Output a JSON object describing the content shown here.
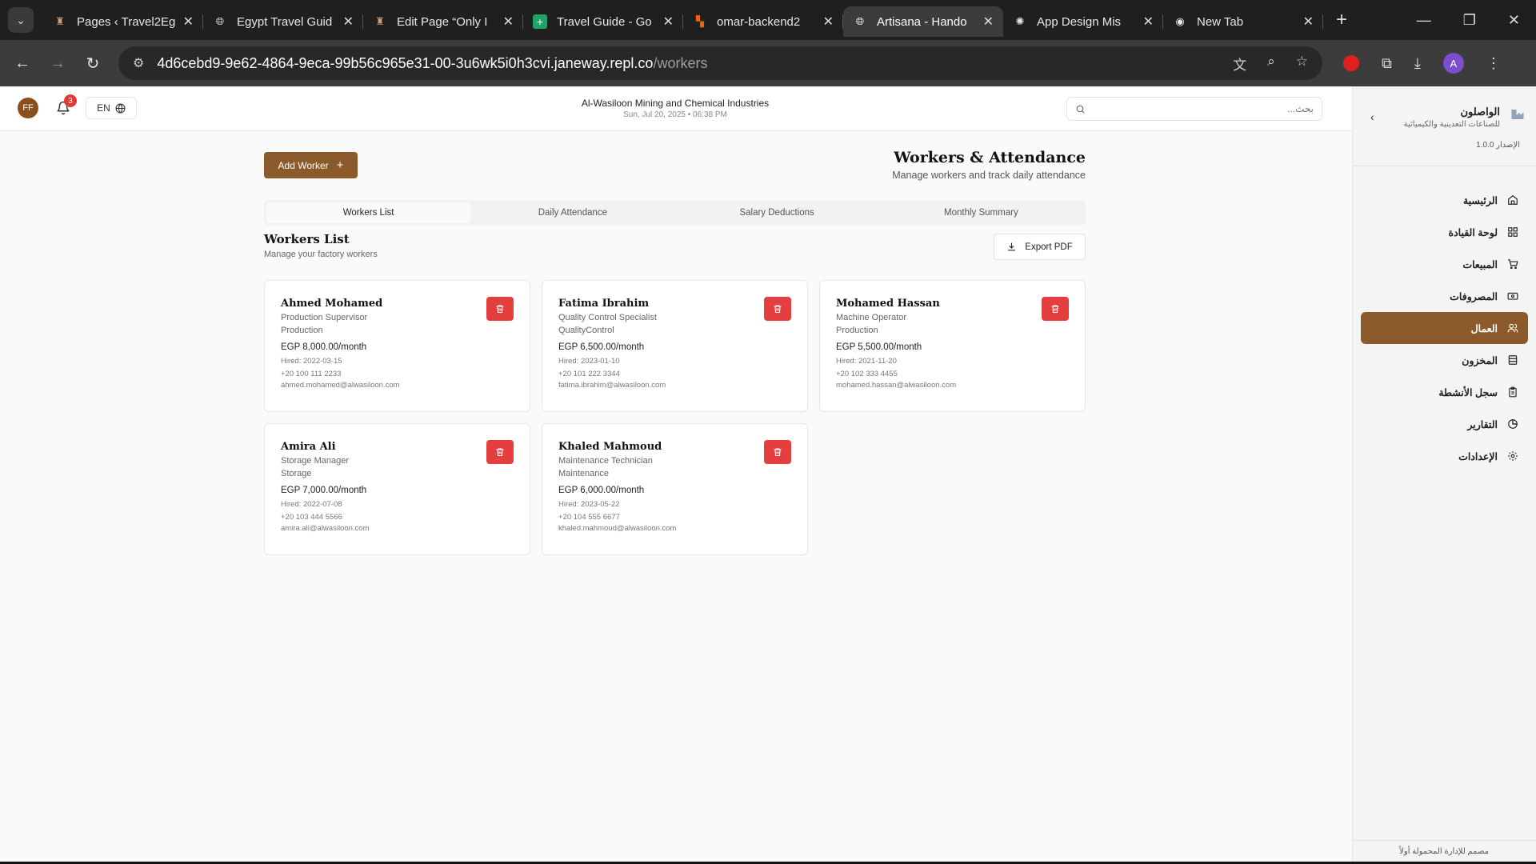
{
  "browser": {
    "tabs": [
      {
        "title": "Pages ‹ Travel2Eg",
        "icon": "site-logo-icon"
      },
      {
        "title": "Egypt Travel Guid",
        "icon": "globe-icon"
      },
      {
        "title": "Edit Page “Only I",
        "icon": "site-logo-icon"
      },
      {
        "title": "Travel Guide - Go",
        "icon": "sheets-icon"
      },
      {
        "title": "omar-backend2",
        "icon": "replit-icon"
      },
      {
        "title": "Artisana - Hando",
        "icon": "globe-icon",
        "active": true
      },
      {
        "title": "App Design Mis",
        "icon": "openai-icon"
      },
      {
        "title": "New Tab",
        "icon": "chrome-icon"
      }
    ],
    "url_host": "4d6cebd9-9e62-4864-9eca-99b56c965e31-00-3u6wk5i0h3cvi.janeway.repl.co",
    "url_path": "/workers",
    "profile_initial": "A"
  },
  "header": {
    "user_initials": "FF",
    "notification_count": "3",
    "language": "EN",
    "company_name": "Al-Wasiloon Mining and Chemical Industries",
    "datetime": "Sun, Jul 20, 2025 • 06:38 PM",
    "search_placeholder": "بحث..."
  },
  "sidebar": {
    "brand_name": "الواصلون",
    "brand_sub": "للصناعات التعدينية والكيميائية",
    "version": "الإصدار 1.0.0",
    "items": [
      {
        "label": "الرئيسية",
        "icon": "home-icon"
      },
      {
        "label": "لوحة القيادة",
        "icon": "dashboard-icon"
      },
      {
        "label": "المبيعات",
        "icon": "cart-icon"
      },
      {
        "label": "المصروفات",
        "icon": "wallet-icon"
      },
      {
        "label": "العمال",
        "icon": "users-icon",
        "active": true
      },
      {
        "label": "المخزون",
        "icon": "inventory-icon"
      },
      {
        "label": "سجل الأنشطة",
        "icon": "clipboard-icon"
      },
      {
        "label": "التقارير",
        "icon": "chart-icon"
      },
      {
        "label": "الإعدادات",
        "icon": "gear-icon"
      }
    ],
    "footer": "مصمم للإدارة المحمولة أولاً"
  },
  "page": {
    "add_worker_label": "Add Worker",
    "title": "Workers & Attendance",
    "subtitle": "Manage workers and track daily attendance",
    "tabs": [
      "Workers List",
      "Daily Attendance",
      "Salary Deductions",
      "Monthly Summary"
    ],
    "section_title": "Workers List",
    "section_subtitle": "Manage your factory workers",
    "export_label": "Export PDF"
  },
  "workers": [
    {
      "name": "Ahmed Mohamed",
      "role": "Production Supervisor",
      "dept": "Production",
      "salary": "EGP 8,000.00/month",
      "hired": "Hired: 2022-03-15",
      "phone": "+20 100 111 2233",
      "email": "ahmed.mohamed@alwasiloon.com"
    },
    {
      "name": "Fatima Ibrahim",
      "role": "Quality Control Specialist",
      "dept": "QualityControl",
      "salary": "EGP 6,500.00/month",
      "hired": "Hired: 2023-01-10",
      "phone": "+20 101 222 3344",
      "email": "fatima.ibrahim@alwasiloon.com"
    },
    {
      "name": "Mohamed Hassan",
      "role": "Machine Operator",
      "dept": "Production",
      "salary": "EGP 5,500.00/month",
      "hired": "Hired: 2021-11-20",
      "phone": "+20 102 333 4455",
      "email": "mohamed.hassan@alwasiloon.com"
    },
    {
      "name": "Amira Ali",
      "role": "Storage Manager",
      "dept": "Storage",
      "salary": "EGP 7,000.00/month",
      "hired": "Hired: 2022-07-08",
      "phone": "+20 103 444 5566",
      "email": "amira.ali@alwasiloon.com"
    },
    {
      "name": "Khaled Mahmoud",
      "role": "Maintenance Technician",
      "dept": "Maintenance",
      "salary": "EGP 6,000.00/month",
      "hired": "Hired: 2023-05-22",
      "phone": "+20 104 555 6677",
      "email": "khaled.mahmoud@alwasiloon.com"
    }
  ],
  "colors": {
    "accent": "#8a5a2b",
    "danger": "#e53e3e",
    "badge": "#e53935"
  }
}
